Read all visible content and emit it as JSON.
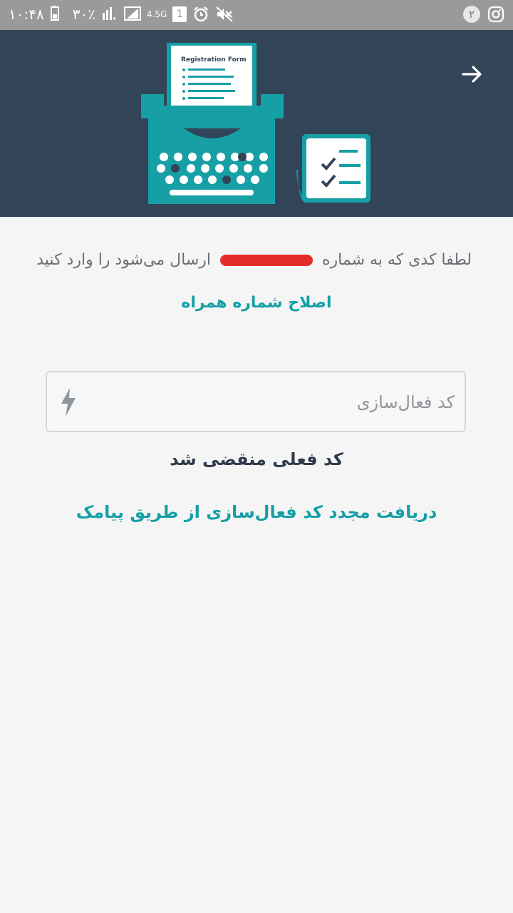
{
  "status_bar": {
    "time": "۱۰:۴۸",
    "battery": "۳۰٪",
    "network": "4.5G",
    "sim": "1",
    "notification_count": "۲"
  },
  "header": {
    "illustration_title": "Registration Form",
    "colors": {
      "background": "#324558",
      "accent": "#16a0a6"
    }
  },
  "main": {
    "instruction_before": "لطفا کدی که به شماره",
    "instruction_after": "ارسال می‌شود را وارد کنید",
    "edit_number_link": "اصلاح شماره همراه",
    "code_placeholder": "کد فعال‌سازی",
    "code_value": "",
    "expired_message": "کد فعلی منقضی شد",
    "resend_link": "دریافت مجدد کد فعال‌سازی از طریق پیامک"
  }
}
